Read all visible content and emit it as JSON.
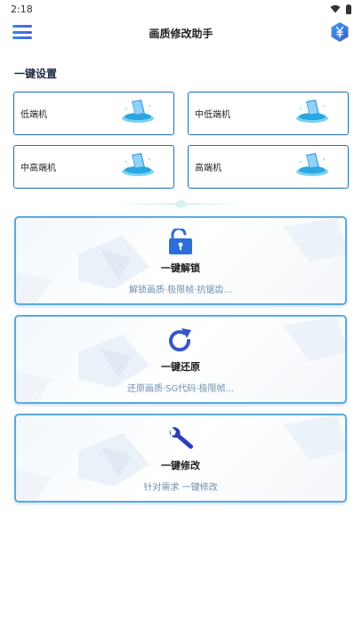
{
  "status_bar": {
    "time": "2:18"
  },
  "app_bar": {
    "title": "画质修改助手"
  },
  "section": {
    "title": "一键设置"
  },
  "presets": [
    {
      "label": "低端机"
    },
    {
      "label": "中低端机"
    },
    {
      "label": "中高端机"
    },
    {
      "label": "高端机"
    }
  ],
  "actions": [
    {
      "title": "一键解锁",
      "subtitle": "解锁画质·极限帧·抗锯齿...",
      "icon": "unlock-icon"
    },
    {
      "title": "一键还原",
      "subtitle": "还原画质·SG代码·极限帧...",
      "icon": "refresh-icon"
    },
    {
      "title": "一键修改",
      "subtitle": "针对需求 一键修改",
      "icon": "wrench-icon"
    }
  ],
  "colors": {
    "accent": "#2c6fd6",
    "border": "#1f6fb3",
    "card_border": "#5aa9df"
  }
}
